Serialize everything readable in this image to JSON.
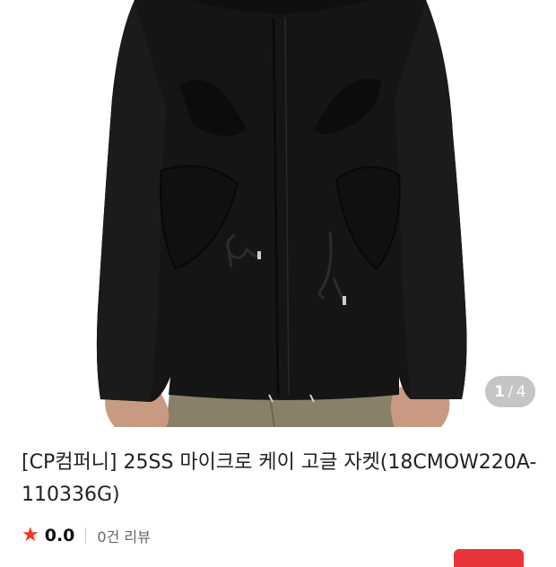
{
  "product": {
    "image_alt": "black jacket product photo",
    "image_counter": {
      "current": "1",
      "separator": "/",
      "total": "4"
    },
    "title": "[CP컴퍼니] 25SS 마이크로 케이 고글 자켓(18CMOW220A-110336G)",
    "rating": {
      "score": "0.0",
      "review_count_text": "0건 리뷰"
    }
  },
  "colors": {
    "accent": "#e8353b",
    "star": "#f0341e",
    "jacket": "#151515"
  },
  "icons": [
    "star-icon"
  ]
}
